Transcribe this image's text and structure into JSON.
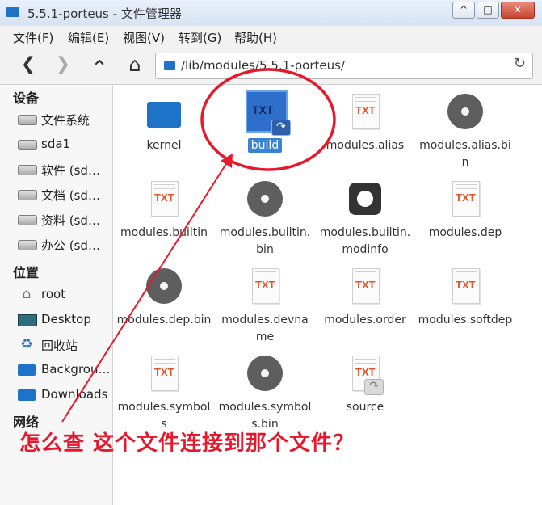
{
  "window": {
    "title": "5.5.1-porteus - 文件管理器",
    "controls": [
      "^",
      "□",
      "✕"
    ]
  },
  "menu": [
    "文件(F)",
    "编辑(E)",
    "视图(V)",
    "转到(G)",
    "帮助(H)"
  ],
  "toolbar": {
    "path": "/lib/modules/5.5.1-porteus/",
    "back": "❮",
    "forward": "❯",
    "up": "⌃",
    "home": "⌂",
    "reload": "↻"
  },
  "sidebar": {
    "devices_header": "设备",
    "devices": [
      {
        "label": "文件系统",
        "icon": "drive-icon"
      },
      {
        "label": "sda1",
        "icon": "drive-icon"
      },
      {
        "label": "软件 (sd…",
        "icon": "drive-icon"
      },
      {
        "label": "文档 (sd…",
        "icon": "drive-icon"
      },
      {
        "label": "资料 (sd…",
        "icon": "drive-icon"
      },
      {
        "label": "办公 (sd…",
        "icon": "drive-icon"
      }
    ],
    "places_header": "位置",
    "places": [
      {
        "label": "root",
        "icon": "home-icon"
      },
      {
        "label": "Desktop",
        "icon": "desktop-icon"
      },
      {
        "label": "回收站",
        "icon": "trash-icon"
      },
      {
        "label": "Backgrou…",
        "icon": "folder-icon"
      },
      {
        "label": "Downloads",
        "icon": "folder-icon"
      }
    ],
    "network_header": "网络"
  },
  "files": [
    {
      "name": "kernel",
      "icon": "folder-icon",
      "selected": false
    },
    {
      "name": "build",
      "icon": "text-file-link-icon",
      "selected": true
    },
    {
      "name": "modules.alias",
      "icon": "text-file-icon",
      "selected": false
    },
    {
      "name": "modules.alias.bin",
      "icon": "binary-file-icon",
      "selected": false
    },
    {
      "name": "modules.builtin",
      "icon": "text-file-icon",
      "selected": false
    },
    {
      "name": "modules.builtin.bin",
      "icon": "binary-file-icon",
      "selected": false
    },
    {
      "name": "modules.builtin.modinfo",
      "icon": "settings-file-icon",
      "selected": false
    },
    {
      "name": "modules.dep",
      "icon": "text-file-icon",
      "selected": false
    },
    {
      "name": "modules.dep.bin",
      "icon": "binary-file-icon",
      "selected": false
    },
    {
      "name": "modules.devname",
      "icon": "text-file-icon",
      "selected": false
    },
    {
      "name": "modules.order",
      "icon": "text-file-icon",
      "selected": false
    },
    {
      "name": "modules.softdep",
      "icon": "text-file-icon",
      "selected": false
    },
    {
      "name": "modules.symbols",
      "icon": "text-file-icon",
      "selected": false
    },
    {
      "name": "modules.symbols.bin",
      "icon": "binary-file-icon",
      "selected": false
    },
    {
      "name": "source",
      "icon": "text-file-link-icon",
      "selected": false
    }
  ],
  "txt_label": "TXT",
  "annotation": {
    "text": "怎么查 这个文件连接到那个文件？",
    "color": "#e8182c"
  }
}
